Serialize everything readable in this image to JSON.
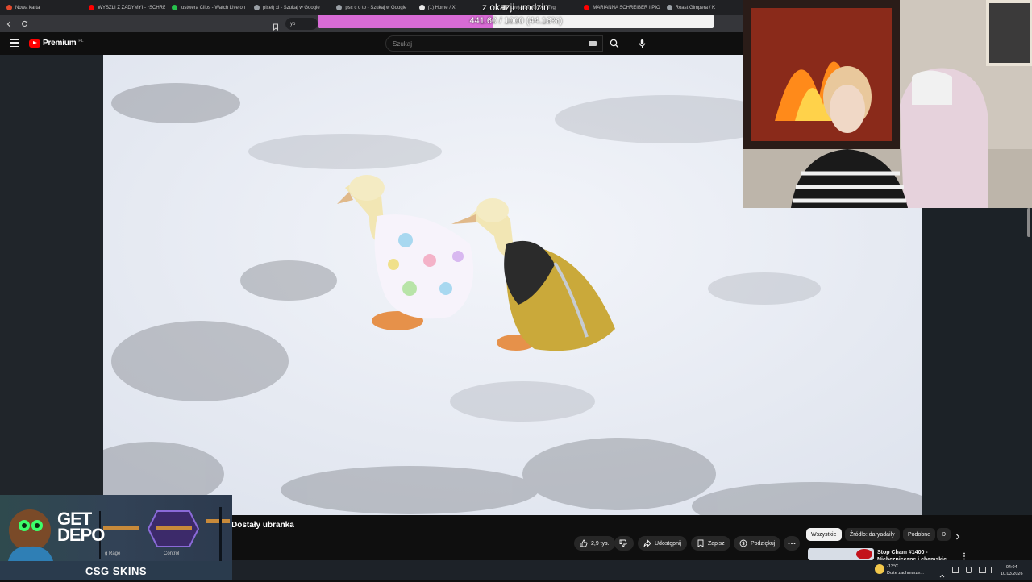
{
  "browser": {
    "tabs": [
      {
        "title": "Nowa karta",
        "color": "#e24a2e"
      },
      {
        "title": "WYSZLI Z ZADYMYI - *SCHREI",
        "color": "#ff0000"
      },
      {
        "title": "justwera Clips - Watch Live on",
        "color": "#27c24c"
      },
      {
        "title": "pixel) xl - Szukaj w Google",
        "color": "#9aa0a6"
      },
      {
        "title": "psc c o to - Szukaj w Google",
        "color": "#9aa0a6"
      },
      {
        "title": "(1) Home / X",
        "color": "#e8e8e8"
      },
      {
        "title": "Lewactwa on X: \"Tyg",
        "color": "#e8e8e8"
      },
      {
        "title": "MARIANNA SCHREIBER I PIOTR",
        "color": "#ff0000"
      },
      {
        "title": "Roast Gimpera / K",
        "color": "#9aa0a6"
      }
    ],
    "url": "yo"
  },
  "goal": {
    "title": "z okazji urodzin",
    "progress_text": "441.60 / 1000 (44.16%)",
    "fraction": 0.4416,
    "fill_color": "#d86bd6"
  },
  "youtube": {
    "brand": "Premium",
    "region": "PL",
    "search_placeholder": "Szukaj",
    "video_title": "Dostały ubranka",
    "actions": {
      "likes": "2,9 tys.",
      "share": "Udostępnij",
      "save": "Zapisz",
      "thanks": "Podziękuj"
    },
    "chips": [
      "Wszystkie",
      "Źródło: daryadaily",
      "Podobne",
      "D"
    ],
    "recommended": {
      "title_line1": "Stop Cham #1400 -",
      "title_line2": "Niebezpieczne i chamskie"
    }
  },
  "sponsor": {
    "headline": "GET DEPO",
    "items": [
      "g Rage",
      "Control"
    ],
    "brand": "CSG SKINS"
  },
  "taskbar": {
    "weather_temp": "-13°C",
    "weather_desc": "Duże zachmurze...",
    "time": "04:04",
    "date": "10.03.2026"
  },
  "icons": {
    "back": "arrow-left-icon",
    "reload": "reload-icon",
    "menu": "hamburger-icon",
    "search": "search-icon",
    "mic": "mic-icon",
    "like": "thumbs-up-icon",
    "dislike": "thumbs-down-icon",
    "share": "share-icon",
    "save": "save-icon",
    "thanks": "dollar-icon",
    "more": "more-icon"
  }
}
